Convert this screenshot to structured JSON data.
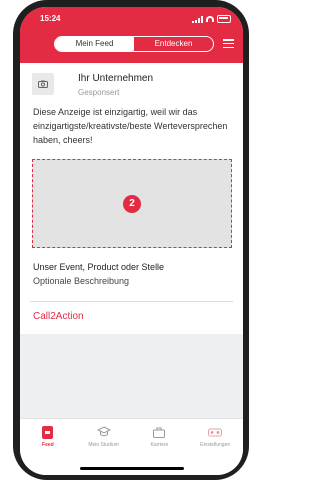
{
  "status_bar": {
    "time": "15:24"
  },
  "header": {
    "tabs": [
      {
        "label": "Mein Feed",
        "active": true
      },
      {
        "label": "Entdecken",
        "active": false
      }
    ],
    "accent_color": "#e32b43"
  },
  "post": {
    "company_name": "Ihr Unternehmen",
    "sponsored_label": "Gesponsert",
    "text": "Diese Anzeige ist einzigartig, weil wir das einzigartigste/kreativste/beste Werteversprechen haben, cheers!",
    "media_number": "2",
    "event_title": "Unser Event, Product oder Stelle",
    "event_description": "Optionale Beschreibung",
    "cta": "Call2Action"
  },
  "bottom_nav": {
    "items": [
      {
        "label": "Feed",
        "icon": "feed-icon",
        "active": true
      },
      {
        "label": "Mein Studium",
        "icon": "graduation-cap-icon",
        "active": false
      },
      {
        "label": "Karriere",
        "icon": "briefcase-icon",
        "active": false
      },
      {
        "label": "Einstellungen",
        "icon": "settings-icon",
        "active": false
      }
    ]
  }
}
